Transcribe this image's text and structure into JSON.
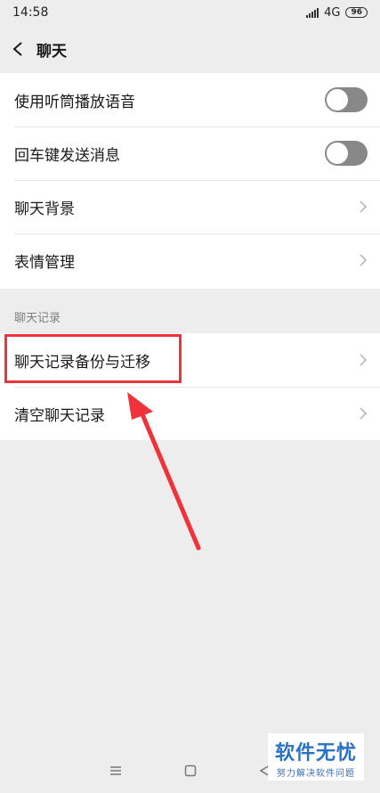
{
  "status_bar": {
    "time": "14:58",
    "network": "4G",
    "battery": "96"
  },
  "header": {
    "title": "聊天"
  },
  "settings": {
    "items": [
      {
        "label": "使用听筒播放语音",
        "type": "toggle",
        "on": false
      },
      {
        "label": "回车键发送消息",
        "type": "toggle",
        "on": false
      },
      {
        "label": "聊天背景",
        "type": "link"
      },
      {
        "label": "表情管理",
        "type": "link"
      }
    ]
  },
  "history_section": {
    "label": "聊天记录",
    "items": [
      {
        "label": "聊天记录备份与迁移",
        "type": "link",
        "highlighted": true
      },
      {
        "label": "清空聊天记录",
        "type": "link"
      }
    ]
  },
  "watermark": {
    "title": "软件无忧",
    "subtitle": "努力解决软件问题"
  },
  "colors": {
    "toggle_off": "#888888",
    "highlight": "#f0323a",
    "watermark": "#2a72c6"
  }
}
